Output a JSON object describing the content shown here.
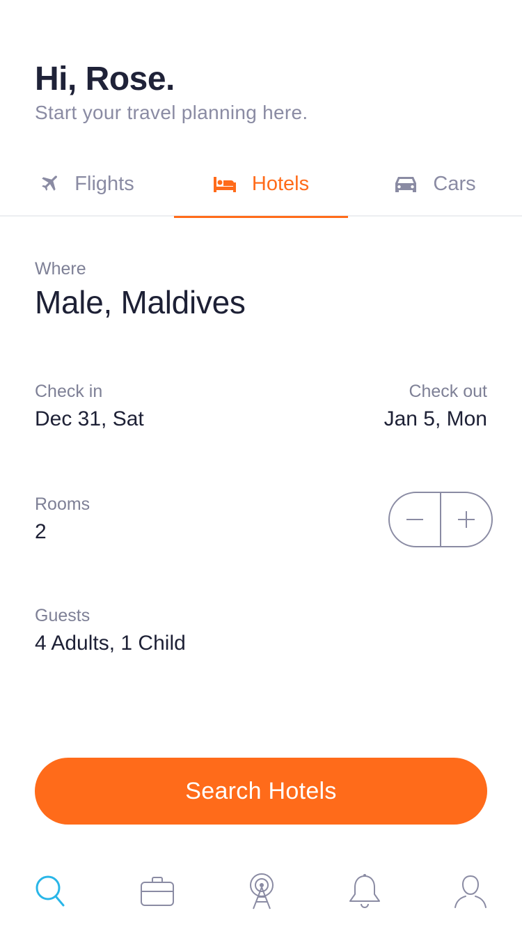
{
  "header": {
    "greeting": "Hi, Rose.",
    "subtitle": "Start your travel planning here."
  },
  "tabs": [
    {
      "label": "Flights",
      "icon": "plane-icon",
      "active": false
    },
    {
      "label": "Hotels",
      "icon": "bed-icon",
      "active": true
    },
    {
      "label": "Cars",
      "icon": "car-icon",
      "active": false
    }
  ],
  "form": {
    "where": {
      "label": "Where",
      "value": "Male, Maldives"
    },
    "check_in": {
      "label": "Check in",
      "value": "Dec 31, Sat"
    },
    "check_out": {
      "label": "Check out",
      "value": "Jan 5, Mon"
    },
    "rooms": {
      "label": "Rooms",
      "value": "2"
    },
    "guests": {
      "label": "Guests",
      "value": "4 Adults, 1 Child"
    }
  },
  "search_button": {
    "label": "Search Hotels"
  },
  "bottom_nav": [
    {
      "icon": "search-icon",
      "active": true
    },
    {
      "icon": "briefcase-icon",
      "active": false
    },
    {
      "icon": "explore-icon",
      "active": false
    },
    {
      "icon": "bell-icon",
      "active": false
    },
    {
      "icon": "profile-icon",
      "active": false
    }
  ],
  "colors": {
    "accent": "#ff6b1a",
    "text_primary": "#1d2035",
    "text_secondary": "#8a8ba3",
    "nav_active": "#29b6e8"
  }
}
